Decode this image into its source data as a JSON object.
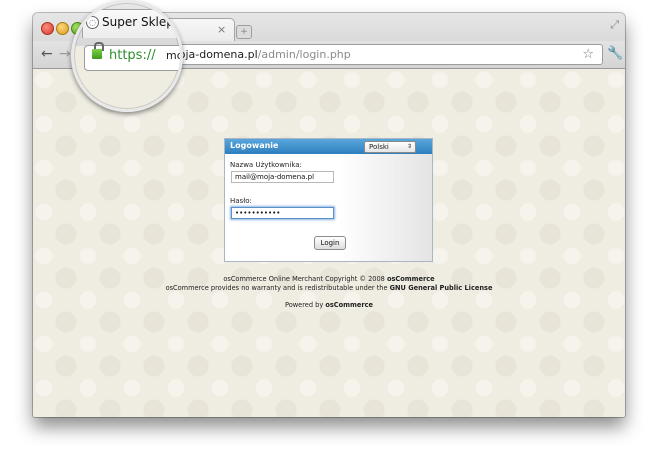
{
  "browser": {
    "tab_title": "Super Sklep",
    "tab_close": "×",
    "new_tab": "+",
    "back": "←",
    "forward": "→",
    "url_scheme": "https",
    "url_sep": "://",
    "url_host": "moja-domena.pl",
    "url_path": "/admin/login.php",
    "star": "☆",
    "wrench": "🔧",
    "resize": "⤢"
  },
  "login": {
    "title": "Logowanie",
    "language": "Polski",
    "language_arrow": "⇕",
    "username_label": "Nazwa Użytkownika:",
    "username_value": "mail@moja-domena.pl",
    "password_label": "Hasło:",
    "password_value": "•••••••••••",
    "submit": "Login"
  },
  "footer": {
    "line1_a": "osCommerce Online Merchant Copyright © 2008 ",
    "line1_b": "osCommerce",
    "line2_a": "osCommerce provides no warranty and is redistributable under the ",
    "line2_b": "GNU General Public License",
    "line3_a": "Powered by ",
    "line3_b": "osCommerce"
  },
  "magnifier": {
    "title": "Super Sklep",
    "https": "https://",
    "url_fragment": "moja-domena.pl"
  }
}
